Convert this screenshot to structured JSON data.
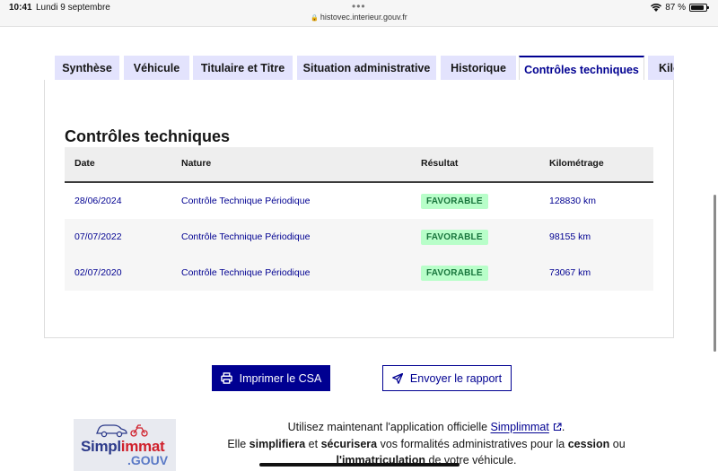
{
  "statusbar": {
    "time": "10:41",
    "date": "Lundi 9 septembre",
    "dots": "•••",
    "url": "histovec.interieur.gouv.fr",
    "battery": "87 %",
    "battery_level": 0.87
  },
  "tabs": [
    {
      "label": "Synthèse",
      "active": false
    },
    {
      "label": "Véhicule",
      "active": false
    },
    {
      "label": "Titulaire et Titre",
      "active": false
    },
    {
      "label": "Situation administrative",
      "active": false
    },
    {
      "label": "Historique",
      "active": false
    },
    {
      "label": "Contrôles techniques",
      "active": true
    },
    {
      "label": "Kilo",
      "active": false
    }
  ],
  "section": {
    "title": "Contrôles techniques"
  },
  "table": {
    "headers": [
      "Date",
      "Nature",
      "Résultat",
      "Kilométrage"
    ],
    "rows": [
      {
        "date": "28/06/2024",
        "nature": "Contrôle Technique Périodique",
        "result": "FAVORABLE",
        "km": "128830 km"
      },
      {
        "date": "07/07/2022",
        "nature": "Contrôle Technique Périodique",
        "result": "FAVORABLE",
        "km": "98155 km"
      },
      {
        "date": "02/07/2020",
        "nature": "Contrôle Technique Périodique",
        "result": "FAVORABLE",
        "km": "73067 km"
      }
    ]
  },
  "actions": {
    "print_label": "Imprimer le CSA",
    "send_label": "Envoyer le rapport"
  },
  "promo": {
    "logo_main": "Simpl",
    "logo_accent": "immat",
    "logo_sub": ".GOUV",
    "line1_pre": "Utilisez maintenant l'application officielle ",
    "line1_link": "Simplimmat",
    "line1_post": ".",
    "line2_a": "Elle ",
    "line2_b": "simplifiera",
    "line2_c": " et ",
    "line2_d": "sécurisera",
    "line2_e": " vos formalités administratives pour la ",
    "line2_f": "cession",
    "line2_g": " ou",
    "line3_a": "l'immatriculation",
    "line3_b": " de votre véhicule."
  },
  "colors": {
    "primary": "#000091",
    "tab_bg": "#e3e3fd",
    "badge_bg": "#b8fec9",
    "badge_fg": "#18753c"
  }
}
